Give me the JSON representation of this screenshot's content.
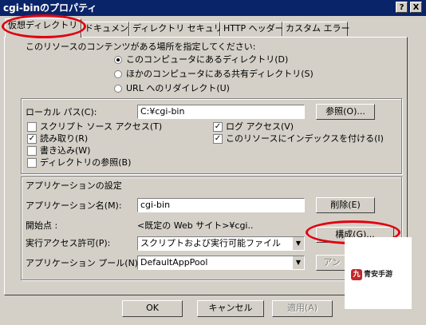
{
  "window": {
    "title": "cgi-binのプロパティ",
    "help_btn": "?",
    "close_btn": "X"
  },
  "tabs": [
    "仮想ディレクトリ",
    "ドキュメント",
    "ディレクトリ セキュリティ",
    "HTTP ヘッダー",
    "カスタム エラー"
  ],
  "source": {
    "heading": "このリソースのコンテンツがある場所を指定してください:",
    "options": [
      "このコンピュータにあるディレクトリ(D)",
      "ほかのコンピュータにある共有ディレクトリ(S)",
      "URL へのリダイレクト(U)"
    ],
    "selected": 0
  },
  "local_path": {
    "label": "ローカル パス(C):",
    "value": "C:¥cgi-bin",
    "browse": "参照(O)..."
  },
  "permissions_left": [
    {
      "label": "スクリプト ソース アクセス(T)",
      "checked": false
    },
    {
      "label": "読み取り(R)",
      "checked": true
    },
    {
      "label": "書き込み(W)",
      "checked": false
    },
    {
      "label": "ディレクトリの参照(B)",
      "checked": false
    }
  ],
  "permissions_right": [
    {
      "label": "ログ アクセス(V)",
      "checked": true
    },
    {
      "label": "このリソースにインデックスを付ける(I)",
      "checked": true
    }
  ],
  "app_settings": {
    "heading": "アプリケーションの設定",
    "name_label": "アプリケーション名(M):",
    "name_value": "cgi-bin",
    "delete_btn": "削除(E)",
    "start_label": "開始点 :",
    "start_value": "<既定の Web サイト>¥cgi..",
    "config_btn": "構成(G)...",
    "exec_label": "実行アクセス許可(P):",
    "exec_value": "スクリプトおよび実行可能ファイル",
    "pool_label": "アプリケーション プール(N):",
    "pool_value": "DefaultAppPool",
    "unload_btn": "アン"
  },
  "footer": {
    "ok": "OK",
    "cancel": "キャンセル",
    "apply": "適用(A)"
  },
  "watermark": {
    "text": "青安手游",
    "icon_char": "九"
  },
  "colors": {
    "titlebar": "#0a246a",
    "annotation": "#e00010",
    "face": "#d4d0c8"
  }
}
